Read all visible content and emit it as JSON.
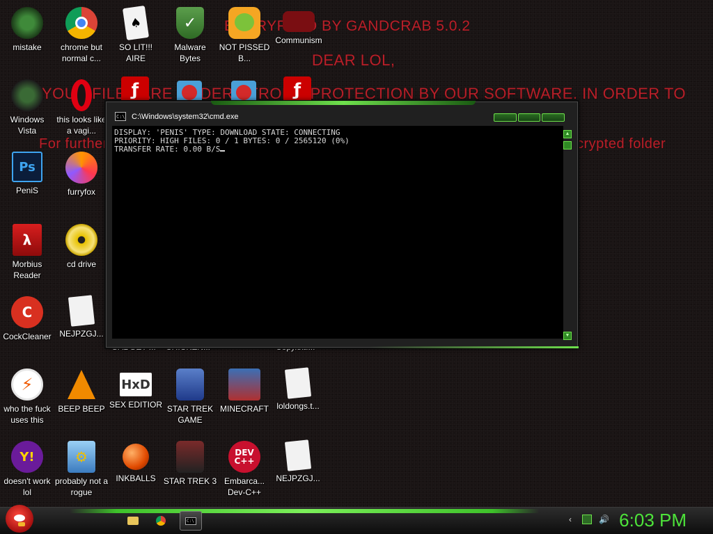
{
  "wallpaper": {
    "line1": "ENCRYPTED BY GANDCRAB 5.0.2",
    "line2": "DEAR LOL,",
    "line3": "YOUR FILES ARE UNDER STRONG PROTECTION BY OUR SOFTWARE. IN ORDER TO",
    "line4": "For further",
    "line5": "crypted folder",
    "text_color": "#b8202a"
  },
  "desktop_icons": [
    {
      "label": "mistake"
    },
    {
      "label": "chrome but normal c..."
    },
    {
      "label": "SO LIT!!! AIRE"
    },
    {
      "label": "Malware Bytes"
    },
    {
      "label": "NOT PISSED B..."
    },
    {
      "label": "Communism"
    },
    {
      "label": "Windows Vista"
    },
    {
      "label": "this looks like a vagi..."
    },
    {
      "label": "PeniS"
    },
    {
      "label": "furryfox"
    },
    {
      "label": "Morbius Reader"
    },
    {
      "label": "cd drive"
    },
    {
      "label": "CockCleaner"
    },
    {
      "label": "NEJPZGJ..."
    },
    {
      "label": "who the fuck uses this"
    },
    {
      "label": "BEEP BEEP"
    },
    {
      "label": "SEX EDITIOR"
    },
    {
      "label": "STAR TREK GAME"
    },
    {
      "label": "MINECRAFT"
    },
    {
      "label": "loldongs.t..."
    },
    {
      "label": "doesn't work lol"
    },
    {
      "label": "probably not a rogue"
    },
    {
      "label": "INKBALLS"
    },
    {
      "label": "STAR TREK 3"
    },
    {
      "label": "Embarca... Dev-C++"
    },
    {
      "label": "NEJPZGJ..."
    }
  ],
  "hidden_labels": {
    "a": "GADGET ...",
    "b": "CHICKEN...",
    "c": "Copy.txt...."
  },
  "cmd": {
    "title": "C:\\Windows\\system32\\cmd.exe",
    "icon_text": "C:\\",
    "line1": "DISPLAY: 'PENIS' TYPE: DOWNLOAD STATE: CONNECTING",
    "line2": "PRIORITY: HIGH FILES: 0 / 1 BYTES: 0 / 2565120 (0%)",
    "line3": "TRANSFER RATE: 0.00 B/S"
  },
  "taskbar": {
    "clock": "6:03 PM",
    "accent": "#4de33a"
  }
}
